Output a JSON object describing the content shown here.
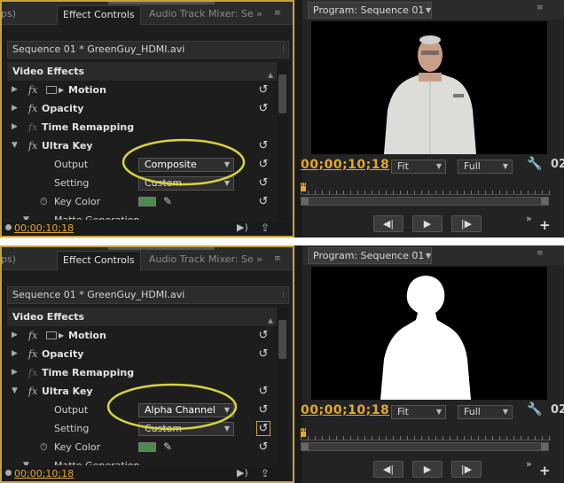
{
  "panels": [
    {
      "effect_controls": {
        "tab_cut_left": "ps)",
        "tab_active": "Effect Controls",
        "tab_other": "Audio Track Mixer: Se",
        "sequence_clip": "Sequence 01 * GreenGuy_HDMI.avi",
        "section": "Video Effects",
        "effects": [
          "Motion",
          "Opacity",
          "Time Remapping",
          "Ultra Key"
        ],
        "output_label": "Output",
        "output_value": "Composite",
        "setting_label": "Setting",
        "setting_value": "Custom",
        "key_color_label": "Key Color",
        "key_color": "#4e8a4e",
        "matte_generation": "Matte Generation",
        "timecode": "00;00;10;18"
      },
      "program": {
        "tab": "Program: Sequence 01",
        "timecode": "00;00;10;18",
        "fit": "Fit",
        "quality": "Full",
        "cut_text": "02",
        "playhead_label": "21",
        "view": "composite"
      }
    },
    {
      "effect_controls": {
        "tab_cut_left": "ps)",
        "tab_active": "Effect Controls",
        "tab_other": "Audio Track Mixer: Se",
        "sequence_clip": "Sequence 01 * GreenGuy_HDMI.avi",
        "section": "Video Effects",
        "effects": [
          "Motion",
          "Opacity",
          "Time Remapping",
          "Ultra Key"
        ],
        "output_label": "Output",
        "output_value": "Alpha Channel",
        "setting_label": "Setting",
        "setting_value": "Custom",
        "key_color_label": "Key Color",
        "key_color": "#4e8a4e",
        "matte_generation": "Matte Generation",
        "timecode": "00;00;10;18"
      },
      "program": {
        "tab": "Program: Sequence 01",
        "timecode": "00;00;10;18",
        "fit": "Fit",
        "quality": "Full",
        "cut_text": "02",
        "playhead_label": "21",
        "view": "alpha"
      }
    }
  ],
  "highlight_color": "#d8d43a",
  "panel_border_color": "#c9a23c",
  "timecode_color": "#e0a82e"
}
